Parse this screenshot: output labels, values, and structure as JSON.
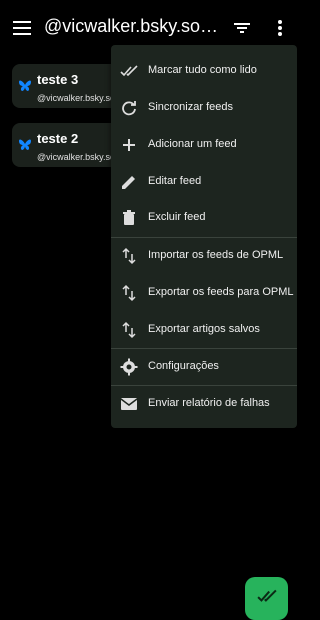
{
  "appbar": {
    "title": "@vicwalker.bsky.socia…",
    "icons": [
      "menu-icon",
      "filter-icon",
      "more-vert-icon"
    ]
  },
  "feeds": [
    {
      "name": "teste 3",
      "handle": "@vicwalker.bsky.social",
      "icon": "butterfly-icon"
    },
    {
      "name": "teste 2",
      "handle": "@vicwalker.bsky.social",
      "icon": "butterfly-icon"
    }
  ],
  "menu": {
    "items": [
      {
        "label": "Marcar tudo como lido",
        "icon": "double-check-icon"
      },
      {
        "label": "Sincronizar feeds",
        "icon": "sync-icon"
      },
      {
        "label": "Adicionar um feed",
        "icon": "plus-icon"
      },
      {
        "label": "Editar feed",
        "icon": "pencil-icon"
      },
      {
        "label": "Excluir feed",
        "icon": "trash-icon"
      },
      {
        "label": "Importar os feeds de OPML",
        "icon": "import-export-icon"
      },
      {
        "label": "Exportar os feeds para OPML",
        "icon": "import-export-icon"
      },
      {
        "label": "Exportar artigos salvos",
        "icon": "import-export-icon"
      },
      {
        "label": "Configurações",
        "icon": "gear-icon"
      },
      {
        "label": "Enviar relatório de falhas",
        "icon": "mail-icon"
      }
    ]
  },
  "fab": {
    "icon": "double-check-icon"
  },
  "colors": {
    "background": "#000000",
    "menu_bg": "#1d251f",
    "card_bg": "#1b211c",
    "accent": "#27b35c",
    "bluesky": "#1185fe"
  }
}
